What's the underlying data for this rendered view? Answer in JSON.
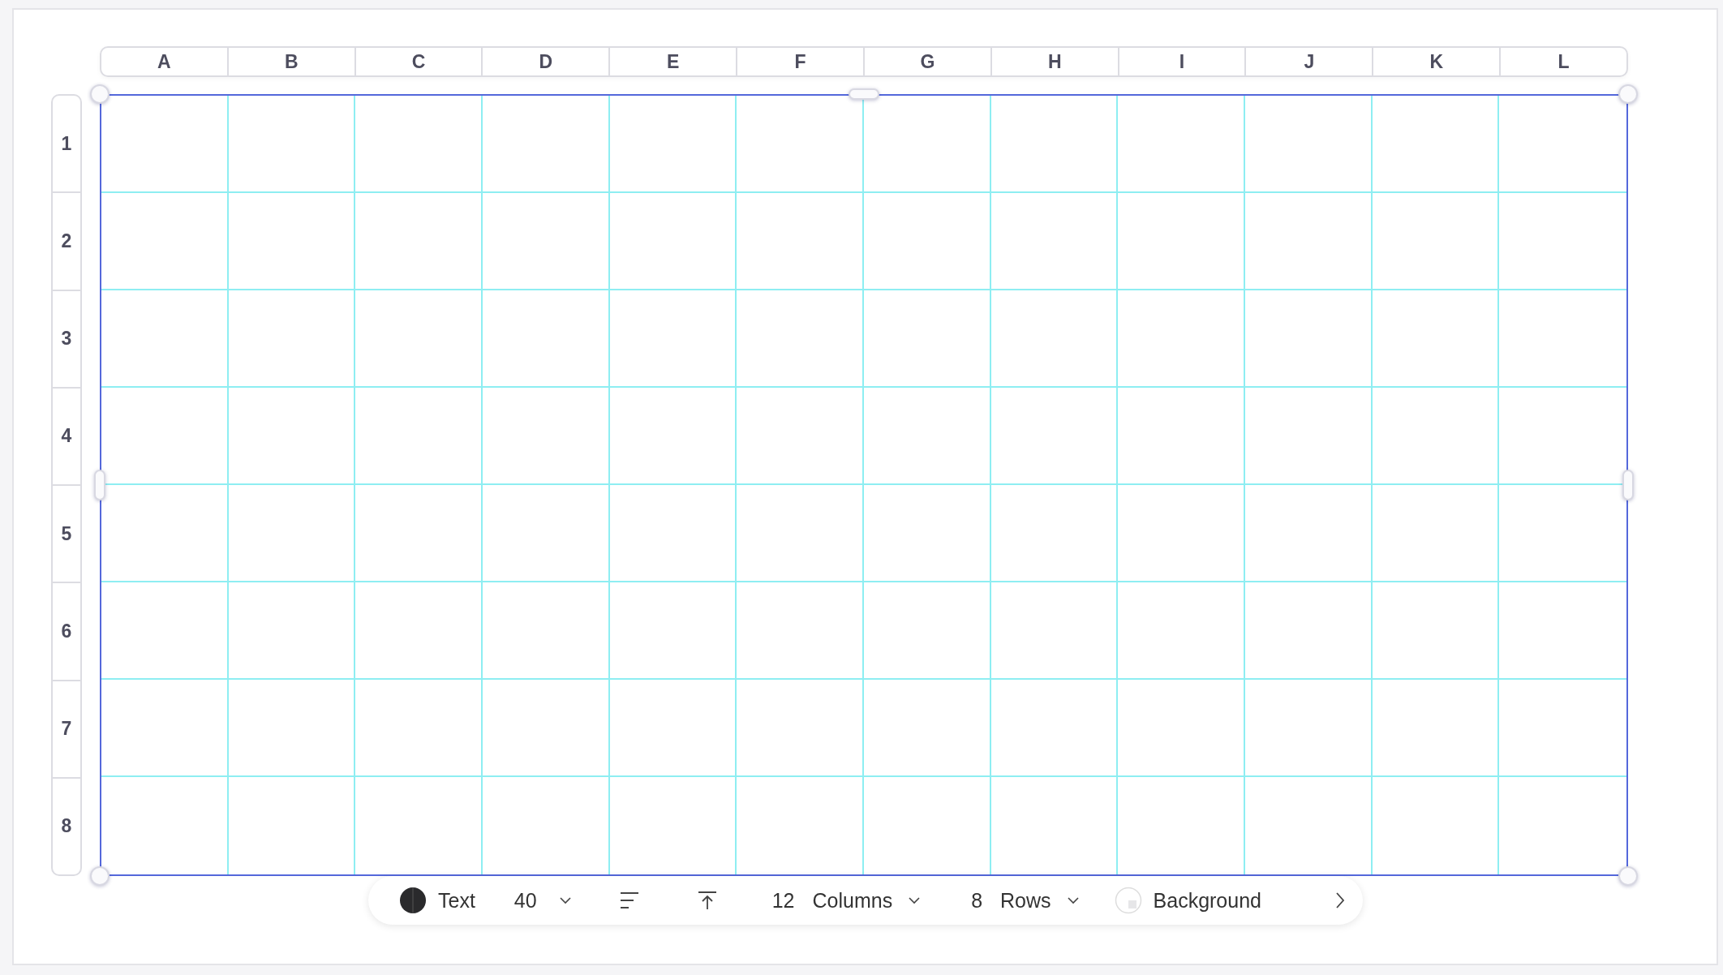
{
  "column_headers": [
    "A",
    "B",
    "C",
    "D",
    "E",
    "F",
    "G",
    "H",
    "I",
    "J",
    "K",
    "L"
  ],
  "row_headers": [
    "1",
    "2",
    "3",
    "4",
    "5",
    "6",
    "7",
    "8"
  ],
  "toolbar": {
    "text_label": "Text",
    "font_size": "40",
    "columns_count": "12",
    "columns_label": "Columns",
    "rows_count": "8",
    "rows_label": "Rows",
    "background_label": "Background"
  }
}
